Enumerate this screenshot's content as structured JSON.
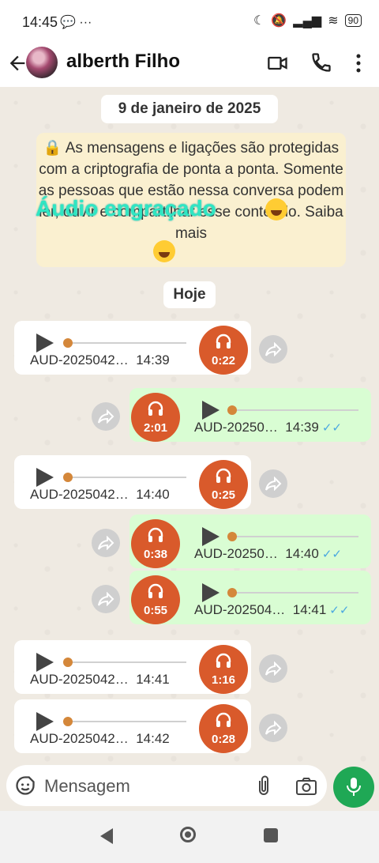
{
  "status_bar": {
    "time": "14:45",
    "left_icons": "💬 ···",
    "battery": "90"
  },
  "header": {
    "contact_name": "alberth Filho"
  },
  "chat": {
    "date_label": "9 de janeiro de 2025",
    "encryption_notice": "🔒 As mensagens e ligações são protegidas com a criptografia de ponta a ponta. Somente as pessoas que estão nessa conversa podem ler, ouvir e compartilhar esse conteúdo. Saiba mais",
    "overlay_caption": "Áudio engraçado",
    "today_label": "Hoje"
  },
  "messages": [
    {
      "dir": "in",
      "file": "AUD-2025042…",
      "time": "14:39",
      "duration": "0:22"
    },
    {
      "dir": "out",
      "file": "AUD-20250…",
      "time": "14:39",
      "duration": "2:01",
      "status": "✓✓"
    },
    {
      "dir": "in",
      "file": "AUD-2025042…",
      "time": "14:40",
      "duration": "0:25"
    },
    {
      "dir": "out",
      "file": "AUD-20250…",
      "time": "14:40",
      "duration": "0:38",
      "status": "✓✓"
    },
    {
      "dir": "out",
      "file": "AUD-202504…",
      "time": "14:41",
      "duration": "0:55",
      "status": "✓✓"
    },
    {
      "dir": "in",
      "file": "AUD-2025042…",
      "time": "14:41",
      "duration": "1:16"
    },
    {
      "dir": "in",
      "file": "AUD-2025042…",
      "time": "14:42",
      "duration": "0:28"
    }
  ],
  "input": {
    "placeholder": "Mensagem"
  },
  "colors": {
    "header_bg": "#ffffff",
    "outgoing_bubble": "#d9fdd3",
    "incoming_bubble": "#ffffff",
    "audio_circle": "#d95a2b",
    "mic_button": "#1fa855",
    "read_ticks": "#4aa8e0"
  }
}
